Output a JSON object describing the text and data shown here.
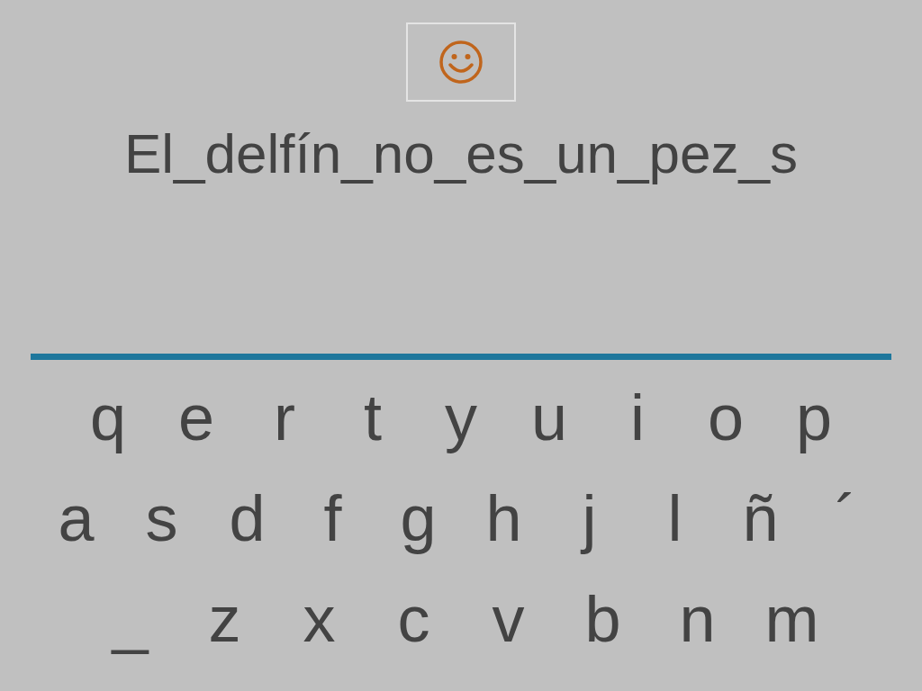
{
  "sentence": "El_delfín_no_es_un_pez_s",
  "keyboard": {
    "rows": [
      [
        "q",
        "e",
        "r",
        "t",
        "y",
        "u",
        "i",
        "o",
        "p"
      ],
      [
        "a",
        "s",
        "d",
        "f",
        "g",
        "h",
        "j",
        "l",
        "ñ",
        "´"
      ],
      [
        "_",
        "z",
        "x",
        "c",
        "v",
        "b",
        "n",
        "m"
      ]
    ]
  }
}
